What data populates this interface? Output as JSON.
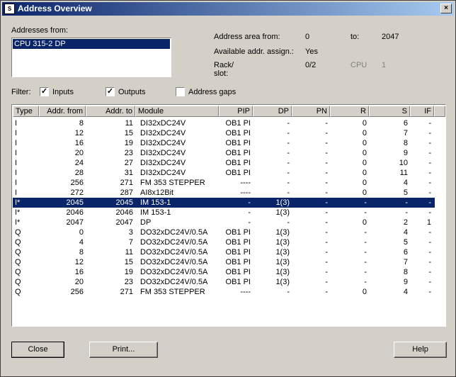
{
  "window": {
    "title": "Address Overview",
    "icon": "app-icon",
    "close_label": "×"
  },
  "addresses_from": {
    "label": "Addresses from:",
    "items": [
      "CPU 315-2 DP"
    ]
  },
  "info": {
    "area_from_label": "Address area from:",
    "area_from_value": "0",
    "to_label": "to:",
    "to_value": "2047",
    "avail_label": "Available addr. assign.:",
    "avail_value": "Yes",
    "rack_label_1": "Rack/",
    "rack_label_2": "slot:",
    "rack_value": "0/2",
    "cpu_label": "CPU",
    "cpu_value": "1"
  },
  "filter": {
    "label": "Filter:",
    "inputs": {
      "label": "Inputs",
      "checked": true
    },
    "outputs": {
      "label": "Outputs",
      "checked": true
    },
    "gaps": {
      "label": "Address gaps",
      "checked": false
    }
  },
  "table": {
    "columns": [
      "Type",
      "Addr. from",
      "Addr. to",
      "Module",
      "PIP",
      "DP",
      "PN",
      "R",
      "S",
      "IF"
    ],
    "rows": [
      [
        "I",
        "8",
        "11",
        "DI32xDC24V",
        "OB1 PI",
        "-",
        "-",
        "0",
        "6",
        "-"
      ],
      [
        "I",
        "12",
        "15",
        "DI32xDC24V",
        "OB1 PI",
        "-",
        "-",
        "0",
        "7",
        "-"
      ],
      [
        "I",
        "16",
        "19",
        "DI32xDC24V",
        "OB1 PI",
        "-",
        "-",
        "0",
        "8",
        "-"
      ],
      [
        "I",
        "20",
        "23",
        "DI32xDC24V",
        "OB1 PI",
        "-",
        "-",
        "0",
        "9",
        "-"
      ],
      [
        "I",
        "24",
        "27",
        "DI32xDC24V",
        "OB1 PI",
        "-",
        "-",
        "0",
        "10",
        "-"
      ],
      [
        "I",
        "28",
        "31",
        "DI32xDC24V",
        "OB1 PI",
        "-",
        "-",
        "0",
        "11",
        "-"
      ],
      [
        "I",
        "256",
        "271",
        "FM 353 STEPPER",
        "----",
        "-",
        "-",
        "0",
        "4",
        "-"
      ],
      [
        "I",
        "272",
        "287",
        "AI8x12Bit",
        "----",
        "-",
        "-",
        "0",
        "5",
        "-"
      ],
      [
        "I*",
        "2045",
        "2045",
        "IM 153-1",
        "-",
        "1(3)",
        "-",
        "-",
        "-",
        "-"
      ],
      [
        "I*",
        "2046",
        "2046",
        "IM 153-1",
        "-",
        "1(3)",
        "-",
        "-",
        "-",
        "-"
      ],
      [
        "I*",
        "2047",
        "2047",
        "DP",
        "-",
        "-",
        "-",
        "0",
        "2",
        "1"
      ],
      [
        "Q",
        "0",
        "3",
        "DO32xDC24V/0.5A",
        "OB1 PI",
        "1(3)",
        "-",
        "-",
        "4",
        "-"
      ],
      [
        "Q",
        "4",
        "7",
        "DO32xDC24V/0.5A",
        "OB1 PI",
        "1(3)",
        "-",
        "-",
        "5",
        "-"
      ],
      [
        "Q",
        "8",
        "11",
        "DO32xDC24V/0.5A",
        "OB1 PI",
        "1(3)",
        "-",
        "-",
        "6",
        "-"
      ],
      [
        "Q",
        "12",
        "15",
        "DO32xDC24V/0.5A",
        "OB1 PI",
        "1(3)",
        "-",
        "-",
        "7",
        "-"
      ],
      [
        "Q",
        "16",
        "19",
        "DO32xDC24V/0.5A",
        "OB1 PI",
        "1(3)",
        "-",
        "-",
        "8",
        "-"
      ],
      [
        "Q",
        "20",
        "23",
        "DO32xDC24V/0.5A",
        "OB1 PI",
        "1(3)",
        "-",
        "-",
        "9",
        "-"
      ],
      [
        "Q",
        "256",
        "271",
        "FM 353 STEPPER",
        "----",
        "-",
        "-",
        "0",
        "4",
        "-"
      ]
    ],
    "selected_row": 8
  },
  "buttons": {
    "close": "Close",
    "print": "Print...",
    "help": "Help"
  },
  "colors": {
    "selection": "#0a246a",
    "face": "#d4d0c8",
    "titlebar": "#0a246a"
  }
}
